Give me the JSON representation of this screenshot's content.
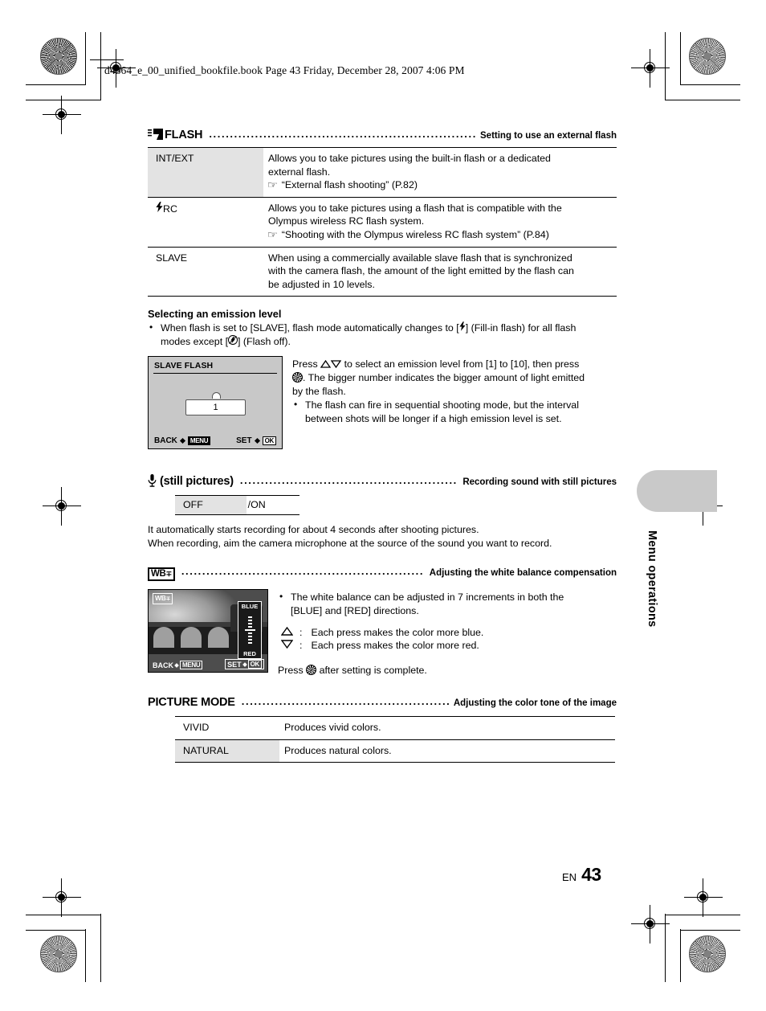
{
  "header": {
    "book_line": "d4364_e_00_unified_bookfile.book  Page 43  Friday, December 28, 2007  4:06 PM"
  },
  "sections": [
    {
      "id": "flash",
      "icon": "flash-icon",
      "title": "FLASH",
      "dots": "..........................................................................",
      "caption": "Setting to use an external flash",
      "table": [
        {
          "key": "INT/EXT",
          "key_shaded": true,
          "lines": [
            "Allows you to take pictures using the built-in flash or a dedicated",
            "external flash."
          ],
          "ref": "“External flash shooting” (P.82)"
        },
        {
          "key": "RC",
          "key_icon": "flash-bolt-icon",
          "key_shaded": false,
          "lines": [
            "Allows you to take pictures using a flash that is compatible with the",
            "Olympus wireless RC flash system."
          ],
          "ref": "“Shooting with the Olympus wireless RC flash system” (P.84)"
        },
        {
          "key": "SLAVE",
          "key_shaded": false,
          "lines": [
            "When using a commercially available slave flash that is synchronized",
            "with the camera flash, the amount of the light emitted by the flash can",
            "be adjusted in 10 levels."
          ],
          "ref": ""
        }
      ]
    }
  ],
  "emission": {
    "subhead": "Selecting an emission level",
    "bullet_line1": "When flash is set to [SLAVE], flash mode automatically changes to [",
    "bullet_line1b": "] (Fill-in flash) for all flash",
    "bullet_line2a": "modes except [",
    "bullet_line2b": "] (Flash off).",
    "lcd": {
      "title": "SLAVE FLASH",
      "value": "1",
      "back_label": "BACK",
      "back_key": "MENU",
      "set_label": "SET",
      "set_key": "OK"
    },
    "body1a": "Press ",
    "body1b": " to select an emission level from [1] to [10], then press",
    "body2a": ". The bigger number indicates the bigger amount of light emitted",
    "body3": "by the flash.",
    "bullet2a": "The flash can fire in sequential shooting mode, but the interval",
    "bullet2b": "between shots will be longer if a high emission level is set."
  },
  "still_pictures": {
    "icon": "microphone-icon",
    "title": "(still pictures)",
    "dots": "............................................................",
    "caption": "Recording sound with still pictures",
    "option_off": "OFF",
    "option_on": "/ON",
    "note1": "It automatically starts recording for about 4 seconds after shooting pictures.",
    "note2": "When recording, aim the camera microphone at the source of the sound you want to record."
  },
  "white_balance": {
    "icon": "wb-compensation-icon",
    "icon_text": "WB",
    "dots": "..........................................................................",
    "caption": "Adjusting the white balance compensation",
    "lcd": {
      "tag": "WB",
      "slider_top": "BLUE",
      "slider_bottom": "RED",
      "back_label": "BACK",
      "back_key": "MENU",
      "set_label": "SET",
      "set_key": "OK"
    },
    "bullet1a": "The white balance can be adjusted in 7 increments in both the",
    "bullet1b": "[BLUE] and [RED] directions.",
    "up_sep": ":",
    "up_text": "Each press makes the color more blue.",
    "down_sep": ":",
    "down_text": "Each press makes the color more red.",
    "press_a": "Press ",
    "press_b": " after setting is complete."
  },
  "picture_mode": {
    "title": "PICTURE MODE",
    "dots": "......................................................",
    "caption": "Adjusting the color tone of the image",
    "rows": [
      {
        "key": "VIVID",
        "key_shaded": false,
        "desc": "Produces vivid colors."
      },
      {
        "key": "NATURAL",
        "key_shaded": true,
        "desc": "Produces natural colors."
      }
    ]
  },
  "side_tab": {
    "label": "Menu operations"
  },
  "footer": {
    "lang": "EN",
    "page": "43"
  },
  "colors": {
    "shade": "#e3e3e3",
    "lcd_bg": "#c8c8c8",
    "tab": "#c9c9c9"
  }
}
